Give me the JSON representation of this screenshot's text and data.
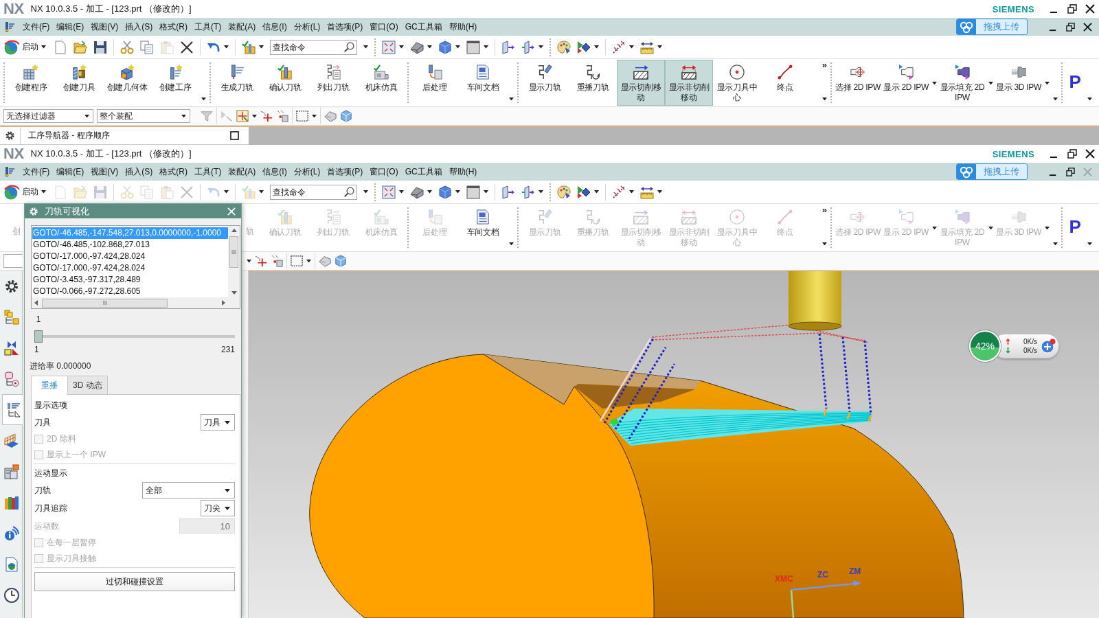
{
  "windows": [
    {
      "logo": "NX",
      "title": "NX 10.0.3.5 - 加工 - [123.prt （修改的）]",
      "brand": "SIEMENS",
      "menu": {
        "items": [
          "文件(F)",
          "编辑(E)",
          "视图(V)",
          "插入(S)",
          "格式(R)",
          "工具(T)",
          "装配(A)",
          "信息(I)",
          "分析(L)",
          "首选项(P)",
          "窗口(O)",
          "GC工具箱",
          "帮助(H)"
        ],
        "upload_button": "拖拽上传",
        "close_disabled": false
      },
      "toolbar": {
        "start": "启动",
        "file_tools_disabled": false,
        "paste_disabled": true,
        "search": {
          "placeholder": "查找命令"
        }
      },
      "ribbon": {
        "groups": [
          {
            "menu": true,
            "items": [
              {
                "label": "创建程序",
                "kind": "program",
                "active": false,
                "disabled": false,
                "menu": false
              },
              {
                "label": "创建刀具",
                "kind": "tool",
                "active": false,
                "disabled": false,
                "menu": false
              },
              {
                "label": "创建几何体",
                "kind": "geometry",
                "active": false,
                "disabled": false,
                "menu": false
              },
              {
                "label": "创建工序",
                "kind": "operation",
                "active": false,
                "disabled": false,
                "menu": false
              }
            ]
          },
          {
            "menu": false,
            "items": [
              {
                "label": "生成刀轨",
                "kind": "generate",
                "active": false,
                "disabled": false,
                "menu": false
              },
              {
                "label": "确认刀轨",
                "kind": "verify",
                "active": false,
                "disabled": false,
                "menu": false
              },
              {
                "label": "列出刀轨",
                "kind": "list",
                "active": false,
                "disabled": false,
                "menu": false
              },
              {
                "label": "机床仿真",
                "kind": "simulate",
                "active": false,
                "disabled": false,
                "menu": false
              }
            ]
          },
          {
            "menu": true,
            "items": [
              {
                "label": "后处理",
                "kind": "postprocess",
                "active": false,
                "disabled": false,
                "menu": false
              },
              {
                "label": "车间文档",
                "kind": "shopdoc",
                "active": false,
                "disabled": false,
                "menu": false
              }
            ]
          },
          {
            "menu": true,
            "overflow": "»",
            "items": [
              {
                "label": "显示刀轨",
                "kind": "showpath",
                "active": false,
                "disabled": false,
                "menu": false
              },
              {
                "label": "重播刀轨",
                "kind": "replay",
                "active": false,
                "disabled": false,
                "menu": false
              },
              {
                "label": "显示切削移动",
                "kind": "cutmoves",
                "active": true,
                "disabled": false,
                "menu": false
              },
              {
                "label": "显示非切削移动",
                "kind": "noncutmoves",
                "active": true,
                "disabled": false,
                "menu": false
              },
              {
                "label": "显示刀具中心",
                "kind": "toolcenter",
                "active": false,
                "disabled": false,
                "menu": false
              },
              {
                "label": "终点",
                "kind": "endpoint",
                "active": false,
                "disabled": false,
                "menu": false
              }
            ]
          },
          {
            "menu": true,
            "items": [
              {
                "label": "选择 2D IPW",
                "kind": "select2d",
                "active": false,
                "disabled": false,
                "menu": false
              },
              {
                "label": "显示 2D IPW",
                "kind": "show2d",
                "active": false,
                "disabled": false,
                "menu": true
              },
              {
                "label": "显示填充 2D IPW",
                "kind": "fill2d",
                "active": false,
                "disabled": false,
                "menu": true
              },
              {
                "label": "显示 3D IPW",
                "kind": "show3d",
                "active": false,
                "disabled": false,
                "menu": true
              }
            ]
          },
          {
            "menu": true,
            "items": [
              {
                "label": "P",
                "kind": "letter",
                "active": false,
                "disabled": false,
                "menu": false
              }
            ]
          }
        ]
      },
      "selection_bar": {
        "filter": "无选择过滤器",
        "scope": "整个装配"
      }
    },
    {
      "logo": "NX",
      "title": "NX 10.0.3.5 - 加工 - [123.prt （修改的）]",
      "brand": "SIEMENS",
      "menu": {
        "items": [
          "文件(F)",
          "编辑(E)",
          "视图(V)",
          "插入(S)",
          "格式(R)",
          "工具(T)",
          "装配(A)",
          "信息(I)",
          "分析(L)",
          "首选项(P)",
          "窗口(O)",
          "GC工具箱",
          "帮助(H)"
        ],
        "upload_button": "拖拽上传",
        "close_disabled": true
      },
      "toolbar": {
        "start": "启动",
        "file_tools_disabled": true,
        "paste_disabled": true,
        "search": {
          "placeholder": "查找命令"
        }
      },
      "ribbon": {
        "cut_labels": [
          {
            "label": "创",
            "disabled": true
          },
          {
            "label": "轨",
            "disabled": true
          }
        ],
        "groups": [
          {
            "menu": false,
            "items": [
              {
                "label": "确认刀轨",
                "kind": "verify",
                "active": false,
                "disabled": true,
                "menu": false
              },
              {
                "label": "列出刀轨",
                "kind": "list",
                "active": false,
                "disabled": true,
                "menu": false
              },
              {
                "label": "机床仿真",
                "kind": "simulate",
                "active": false,
                "disabled": true,
                "menu": false
              }
            ]
          },
          {
            "menu": true,
            "items": [
              {
                "label": "后处理",
                "kind": "postprocess",
                "active": false,
                "disabled": true,
                "menu": false
              },
              {
                "label": "车间文档",
                "kind": "shopdoc",
                "active": false,
                "disabled": false,
                "menu": false
              }
            ]
          },
          {
            "menu": true,
            "overflow": "»",
            "items": [
              {
                "label": "显示刀轨",
                "kind": "showpath",
                "active": false,
                "disabled": true,
                "menu": false
              },
              {
                "label": "重播刀轨",
                "kind": "replay",
                "active": false,
                "disabled": true,
                "menu": false
              },
              {
                "label": "显示切削移动",
                "kind": "cutmoves",
                "active": false,
                "disabled": true,
                "menu": false
              },
              {
                "label": "显示非切削移动",
                "kind": "noncutmoves",
                "active": false,
                "disabled": true,
                "menu": false
              },
              {
                "label": "显示刀具中心",
                "kind": "toolcenter",
                "active": false,
                "disabled": true,
                "menu": false
              },
              {
                "label": "终点",
                "kind": "endpoint",
                "active": false,
                "disabled": true,
                "menu": false
              }
            ]
          },
          {
            "menu": true,
            "items": [
              {
                "label": "选择 2D IPW",
                "kind": "select2d",
                "active": false,
                "disabled": true,
                "menu": false
              },
              {
                "label": "显示 2D IPW",
                "kind": "show2d",
                "active": false,
                "disabled": true,
                "menu": true
              },
              {
                "label": "显示填充 2D IPW",
                "kind": "fill2d",
                "active": false,
                "disabled": true,
                "menu": true
              },
              {
                "label": "显示 3D IPW",
                "kind": "show3d",
                "active": false,
                "disabled": true,
                "menu": true
              }
            ]
          },
          {
            "menu": true,
            "items": [
              {
                "label": "P",
                "kind": "letter",
                "active": false,
                "disabled": false,
                "menu": false
              }
            ]
          }
        ]
      }
    }
  ],
  "navigator": {
    "title": "工序导航器 - 程序顺序"
  },
  "resource_bar": [
    {
      "kind": "settings",
      "selected": false
    },
    {
      "kind": "assembly",
      "selected": false
    },
    {
      "kind": "constraints",
      "selected": false
    },
    {
      "kind": "part",
      "selected": false
    },
    {
      "kind": "operations",
      "selected": true
    },
    {
      "kind": "machine",
      "selected": false
    },
    {
      "kind": "library",
      "selected": false
    },
    {
      "kind": "history",
      "selected": false
    },
    {
      "kind": "info",
      "selected": false
    },
    {
      "kind": "web",
      "selected": false
    },
    {
      "kind": "clock",
      "selected": false
    }
  ],
  "dialog": {
    "title": "刀轨可视化",
    "listing": [
      {
        "text": "GOTO/-46.485,-147.548,27.013,0.0000000,-1.0000",
        "selected": true
      },
      {
        "text": "GOTO/-46.485,-102.868,27.013",
        "selected": false
      },
      {
        "text": "GOTO/-17.000,-97.424,28.024",
        "selected": false
      },
      {
        "text": "GOTO/-17.000,-97.424,28.024",
        "selected": false
      },
      {
        "text": "GOTO/-3.453,-97.317,28.489",
        "selected": false
      },
      {
        "text": "GOTO/-0.066,-97.272,28.605",
        "selected": false
      }
    ],
    "slider": {
      "value": "1",
      "min": "1",
      "max": "231",
      "level": 0
    },
    "feed_rate": "进给率 0.000000",
    "tabs": [
      {
        "label": "重播",
        "selected": true
      },
      {
        "label": "3D 动态",
        "selected": false
      }
    ],
    "sections": [
      {
        "title": "显示选项",
        "rows": [
          {
            "kind": "select",
            "label": "刀具",
            "value": "刀具",
            "disabled": false
          },
          {
            "kind": "checkbox",
            "label": "2D 除料",
            "checked": false,
            "disabled": true
          },
          {
            "kind": "checkbox",
            "label": "显示上一个 IPW",
            "checked": false,
            "disabled": true
          }
        ]
      },
      {
        "title": "运动显示",
        "rows": [
          {
            "kind": "dropdown",
            "label": "刀轨",
            "value": "全部",
            "disabled": false
          },
          {
            "kind": "select",
            "label": "刀具追踪",
            "value": "刀尖",
            "disabled": false
          },
          {
            "kind": "number",
            "label": "运动数",
            "value": "10",
            "disabled": true
          },
          {
            "kind": "checkbox",
            "label": "在每一层暂停",
            "checked": false,
            "disabled": true
          },
          {
            "kind": "checkbox",
            "label": "显示刀具接触",
            "checked": false,
            "disabled": true
          }
        ]
      }
    ],
    "button": "过切和碰撞设置"
  },
  "viewport": {
    "axes": [
      {
        "label": "XMC",
        "color": "#e02a1a"
      },
      {
        "label": "ZC",
        "color": "#3a3ac8"
      },
      {
        "label": "ZM",
        "color": "#3a3ac8"
      }
    ],
    "widget": {
      "percent": "42%",
      "upload": "0K/s",
      "download": "0K/s"
    }
  }
}
